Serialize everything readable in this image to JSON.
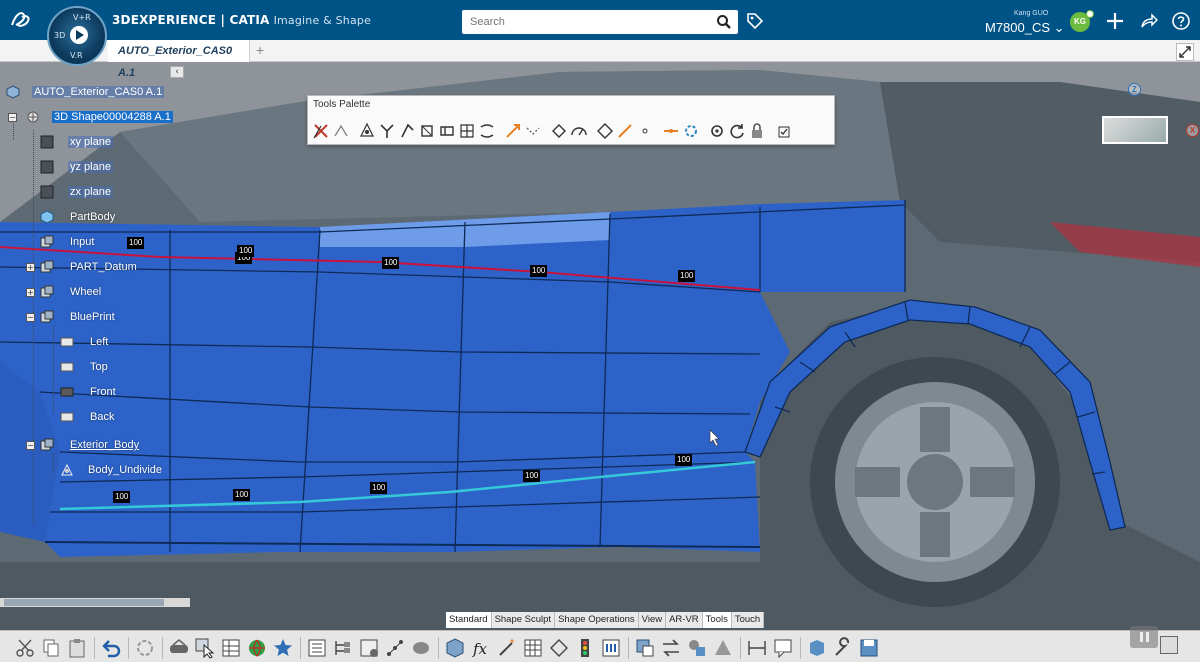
{
  "header": {
    "brand": "3DEXPERIENCE | CATIA",
    "brand_sub": "Imagine & Shape",
    "compass_labels": {
      "top": "V+R",
      "left": "3D",
      "bottom": "V.R"
    },
    "search_placeholder": "Search",
    "user_name": "Kang GUO",
    "tenant": "M7800_CS",
    "avatar_initials": "KG",
    "accent": "#005386"
  },
  "tabs": [
    {
      "label": "AUTO_Exterior_CAS0 A.1"
    }
  ],
  "tree": {
    "root": "AUTO_Exterior_CAS0 A.1",
    "items": [
      {
        "label": "3D Shape00004288 A.1",
        "icon": "3dshape-icon"
      },
      {
        "label": "xy plane",
        "icon": "plane-icon"
      },
      {
        "label": "yz plane",
        "icon": "plane-icon"
      },
      {
        "label": "zx plane",
        "icon": "plane-icon"
      },
      {
        "label": "PartBody",
        "icon": "body-icon"
      },
      {
        "label": "Input",
        "icon": "geoset-icon"
      },
      {
        "label": "PART_Datum",
        "icon": "geoset-icon"
      },
      {
        "label": "Wheel",
        "icon": "geoset-icon"
      },
      {
        "label": "BluePrint",
        "icon": "geoset-icon"
      },
      {
        "label": "Left",
        "icon": "image-icon"
      },
      {
        "label": "Top",
        "icon": "image-icon"
      },
      {
        "label": "Front",
        "icon": "image-icon"
      },
      {
        "label": "Back",
        "icon": "image-icon"
      },
      {
        "label": "Exterior_Body",
        "icon": "geoset-icon"
      },
      {
        "label": "Body_Undivide",
        "icon": "subd-icon"
      }
    ]
  },
  "palette": {
    "title": "Tools Palette"
  },
  "viewcube": {
    "z_label": "Z",
    "x_label": "X"
  },
  "badges": [
    "100",
    "100",
    "100",
    "100",
    "100",
    "100",
    "100",
    "100",
    "100",
    "100",
    "100"
  ],
  "sections": [
    "Standard",
    "Shape Sculpt",
    "Shape Operations",
    "View",
    "AR-VR",
    "Tools",
    "Touch"
  ],
  "active_section": "Tools",
  "colors": {
    "surface": "#2d63c9",
    "surface_light": "#5b8ee0",
    "car_body": "#5c6770",
    "edge_line": "#0e2a57",
    "red_curve": "#c8143c",
    "cyan_curve": "#35c8d8"
  }
}
